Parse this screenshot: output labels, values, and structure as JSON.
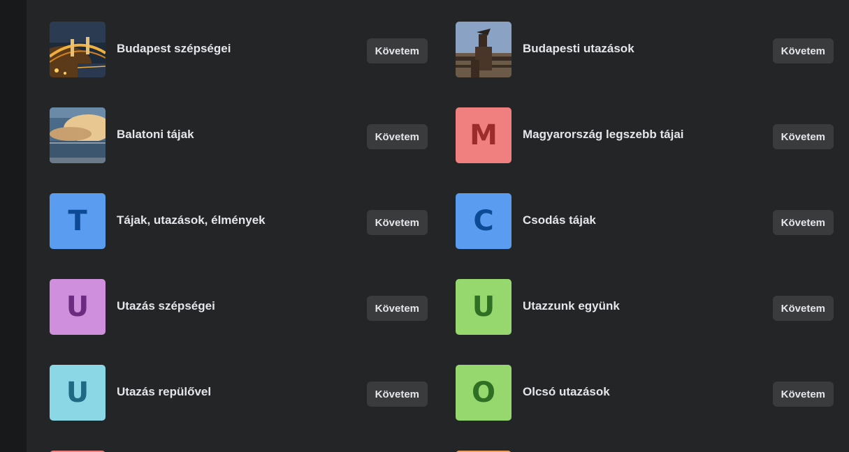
{
  "follow_label": "Követem",
  "groups": [
    {
      "name": "Budapest szépségei",
      "thumb": "photo-chain-bridge-night"
    },
    {
      "name": "Budapesti utazások",
      "thumb": "photo-statue-city"
    },
    {
      "name": "Balatoni tájak",
      "thumb": "photo-lake-clouds"
    },
    {
      "name": "Magyarország legszebb tájai",
      "letter": "M",
      "bg": "#f08080",
      "fg": "#9c2b2b"
    },
    {
      "name": "Tájak, utazások, élmények",
      "letter": "T",
      "bg": "#5a9cf0",
      "fg": "#0d4a96"
    },
    {
      "name": "Csodás tájak",
      "letter": "C",
      "bg": "#5a9cf0",
      "fg": "#0d4a96"
    },
    {
      "name": "Utazás szépségei",
      "letter": "U",
      "bg": "#cf8fdc",
      "fg": "#6b2c80"
    },
    {
      "name": "Utazzunk együnk",
      "letter": "U",
      "bg": "#96d86e",
      "fg": "#2e6f24"
    },
    {
      "name": "Utazás repülővel",
      "letter": "U",
      "bg": "#8cd7e6",
      "fg": "#1f6a82"
    },
    {
      "name": "Olcsó utazások",
      "letter": "O",
      "bg": "#96d86e",
      "fg": "#2e6f24"
    }
  ],
  "colors": {
    "panel": "#242526",
    "page": "#18191a",
    "button": "#3a3b3c",
    "text": "#e4e6eb",
    "partial_left": "#f08080",
    "partial_right": "#f0a060"
  }
}
